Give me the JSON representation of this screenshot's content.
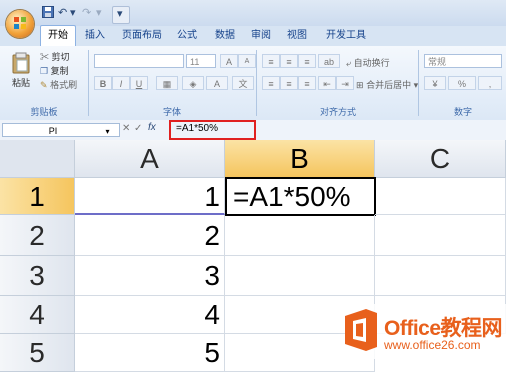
{
  "quick_access": {
    "undo_glyph": "↶",
    "redo_glyph": "↷",
    "more_glyph": "▾"
  },
  "tabs": [
    "开始",
    "插入",
    "页面布局",
    "公式",
    "数据",
    "审阅",
    "视图",
    "开发工具"
  ],
  "clipboard": {
    "paste": "粘贴",
    "cut": "剪切",
    "copy": "复制",
    "format_painter": "格式刷",
    "group": "剪贴板"
  },
  "font": {
    "name": "",
    "size": "11",
    "group": "字体",
    "bold": "B",
    "italic": "I",
    "underline": "U",
    "grow": "A",
    "shrink": "A"
  },
  "alignment": {
    "wrap": "自动换行",
    "merge": "合并后居中",
    "group": "对齐方式"
  },
  "number": {
    "format": "常规",
    "percent": "%",
    "group": "数字"
  },
  "formula_bar": {
    "name_box": "PI",
    "cancel": "✕",
    "enter": "✓",
    "fx": "fx",
    "formula": "=A1*50%"
  },
  "columns": [
    "A",
    "B",
    "C"
  ],
  "rows": [
    "1",
    "2",
    "3",
    "4",
    "5"
  ],
  "cells": {
    "A1": "1",
    "B1": "=A1*50%",
    "A2": "2",
    "A3": "3",
    "A4": "4",
    "A5": "5"
  },
  "watermark": {
    "line1": "Office教程网",
    "line2": "www.office26.com"
  },
  "colors": {
    "accent": "#e8601c",
    "selected_header": "#f5c55e",
    "highlight": "#e02020"
  }
}
